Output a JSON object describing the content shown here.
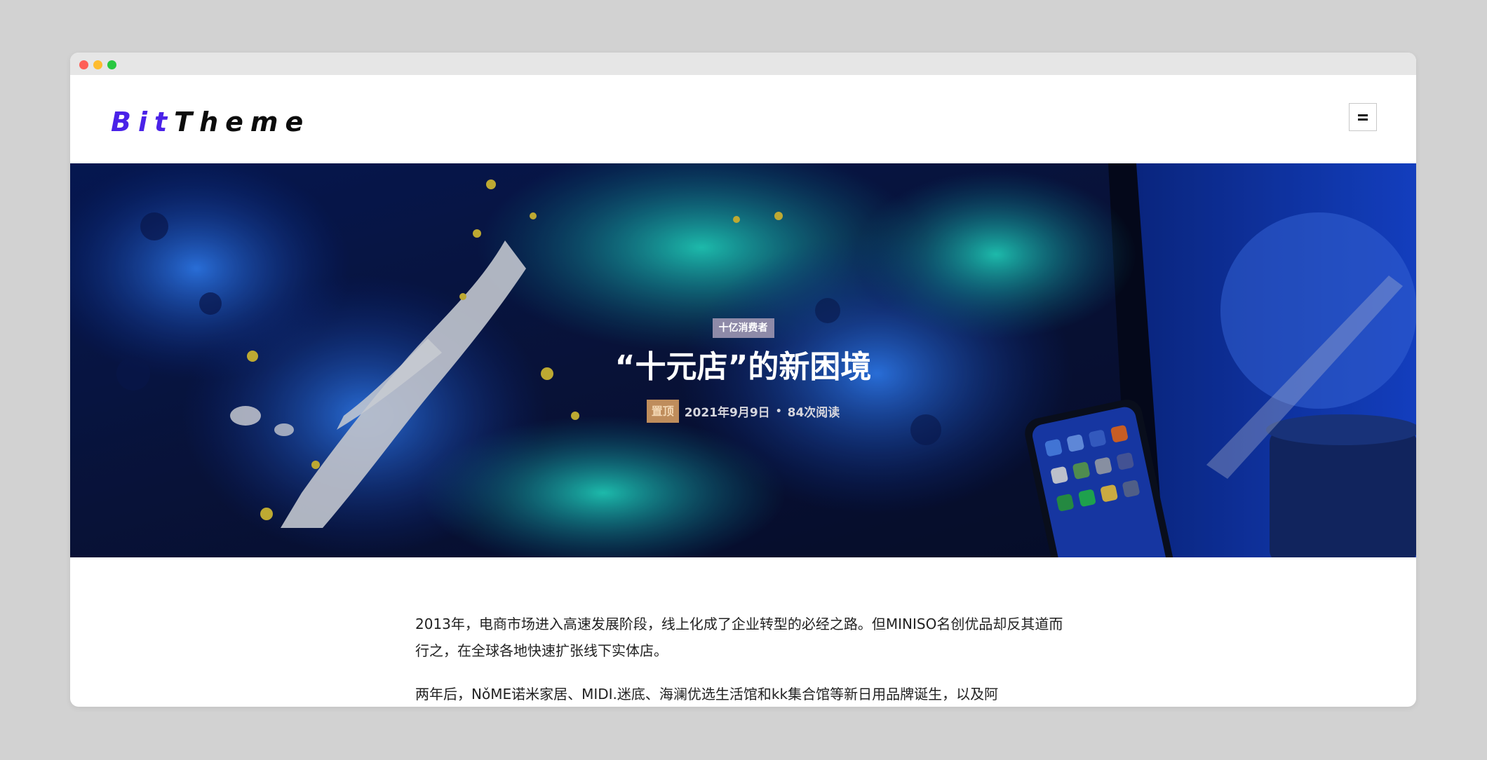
{
  "site": {
    "logo_part1": "Bit",
    "logo_part2": "Theme"
  },
  "header": {
    "menu_button": "menu-icon"
  },
  "post": {
    "category": "十亿消费者",
    "title": "“十元店”的新困境",
    "sticky_label": "置顶",
    "date": "2021年9月9日",
    "separator": "•",
    "reads": "84次阅读"
  },
  "article": {
    "paragraphs": [
      "2013年，电商市场进入高速发展阶段，线上化成了企业转型的必经之路。但MINISO名创优品却反其道而行之，在全球各地快速扩张线下实体店。",
      "两年后，NǒME诺米家居、MIDI.迷底、海澜优选生活馆和kk集合馆等新日用品牌诞生，以及阿"
    ]
  },
  "colors": {
    "logo_accent": "#4a22e8",
    "category_bg": "#8e8aa8",
    "sticky_bg": "#bf8d5c"
  }
}
